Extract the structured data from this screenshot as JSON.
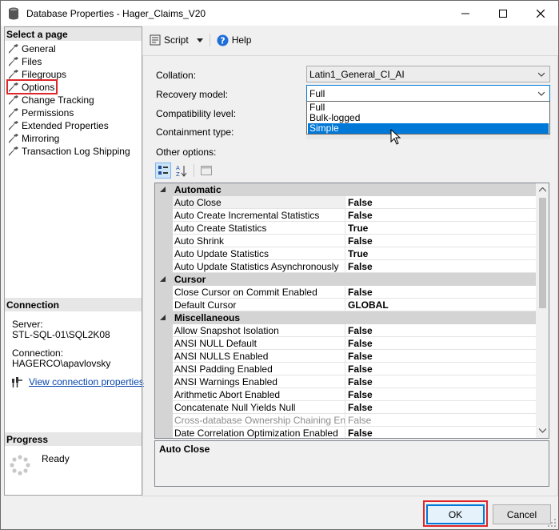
{
  "window": {
    "title": "Database Properties - Hager_Claims_V20"
  },
  "left": {
    "select_page_header": "Select a page",
    "pages": [
      {
        "label": "General"
      },
      {
        "label": "Files"
      },
      {
        "label": "Filegroups"
      },
      {
        "label": "Options"
      },
      {
        "label": "Change Tracking"
      },
      {
        "label": "Permissions"
      },
      {
        "label": "Extended Properties"
      },
      {
        "label": "Mirroring"
      },
      {
        "label": "Transaction Log Shipping"
      }
    ],
    "selected_page": "Options",
    "connection_header": "Connection",
    "server_label": "Server:",
    "server_value": "STL-SQL-01\\SQL2K08",
    "connection_label": "Connection:",
    "connection_value": "HAGERCO\\apavlovsky",
    "view_connection_link": "View connection properties",
    "progress_header": "Progress",
    "progress_status": "Ready"
  },
  "toolbar": {
    "script_label": "Script",
    "help_label": "Help"
  },
  "form": {
    "collation_label": "Collation:",
    "collation_value": "Latin1_General_CI_AI",
    "recovery_label": "Recovery model:",
    "recovery_value": "Full",
    "recovery_options": [
      "Full",
      "Bulk-logged",
      "Simple"
    ],
    "recovery_highlighted": "Simple",
    "compat_label": "Compatibility level:",
    "containment_label": "Containment type:",
    "other_options_label": "Other options:"
  },
  "grid": {
    "categories": [
      {
        "name": "Automatic",
        "rows": [
          {
            "name": "Auto Close",
            "value": "False"
          },
          {
            "name": "Auto Create Incremental Statistics",
            "value": "False"
          },
          {
            "name": "Auto Create Statistics",
            "value": "True"
          },
          {
            "name": "Auto Shrink",
            "value": "False"
          },
          {
            "name": "Auto Update Statistics",
            "value": "True"
          },
          {
            "name": "Auto Update Statistics Asynchronously",
            "value": "False"
          }
        ]
      },
      {
        "name": "Cursor",
        "rows": [
          {
            "name": "Close Cursor on Commit Enabled",
            "value": "False"
          },
          {
            "name": "Default Cursor",
            "value": "GLOBAL"
          }
        ]
      },
      {
        "name": "Miscellaneous",
        "rows": [
          {
            "name": "Allow Snapshot Isolation",
            "value": "False"
          },
          {
            "name": "ANSI NULL Default",
            "value": "False"
          },
          {
            "name": "ANSI NULLS Enabled",
            "value": "False"
          },
          {
            "name": "ANSI Padding Enabled",
            "value": "False"
          },
          {
            "name": "ANSI Warnings Enabled",
            "value": "False"
          },
          {
            "name": "Arithmetic Abort Enabled",
            "value": "False"
          },
          {
            "name": "Concatenate Null Yields Null",
            "value": "False"
          },
          {
            "name": "Cross-database Ownership Chaining Enabled",
            "value": "False"
          },
          {
            "name": "Date Correlation Optimization Enabled",
            "value": "False"
          }
        ]
      }
    ]
  },
  "description": {
    "title": "Auto Close"
  },
  "buttons": {
    "ok": "OK",
    "cancel": "Cancel"
  },
  "colors": {
    "accent": "#0078d7",
    "highlight_red": "#e0262a"
  }
}
